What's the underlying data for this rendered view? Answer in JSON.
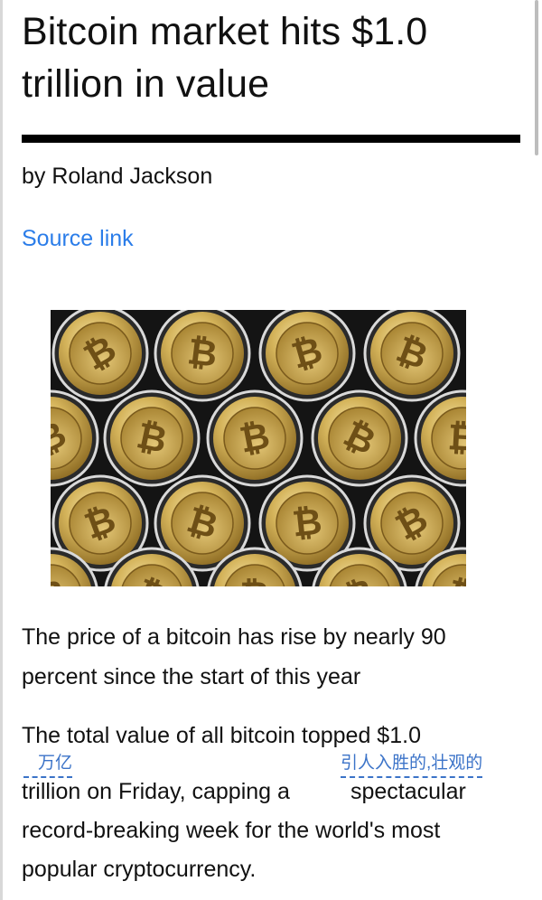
{
  "article": {
    "title": "Bitcoin market hits $1.0 trillion in value",
    "byline": "by Roland Jackson",
    "source_link": "Source link",
    "image_alt": "Bitcoin coins",
    "paragraph_1": "The price of a bitcoin has rise by nearly 90 percent since the start of this year",
    "paragraph_2_lines": [
      "The total value of all bitcoin topped $1.0",
      "trillion on Friday, capping a",
      "spectacular",
      "record-breaking week for the world's most",
      "popular cryptocurrency."
    ]
  },
  "translations": {
    "trillion": "万亿",
    "spectacular": "引人入胜的,壮观的"
  },
  "colors": {
    "link": "#2b7de9",
    "gloss": "#3b73c8",
    "coin_gold": "#c9a74a"
  }
}
